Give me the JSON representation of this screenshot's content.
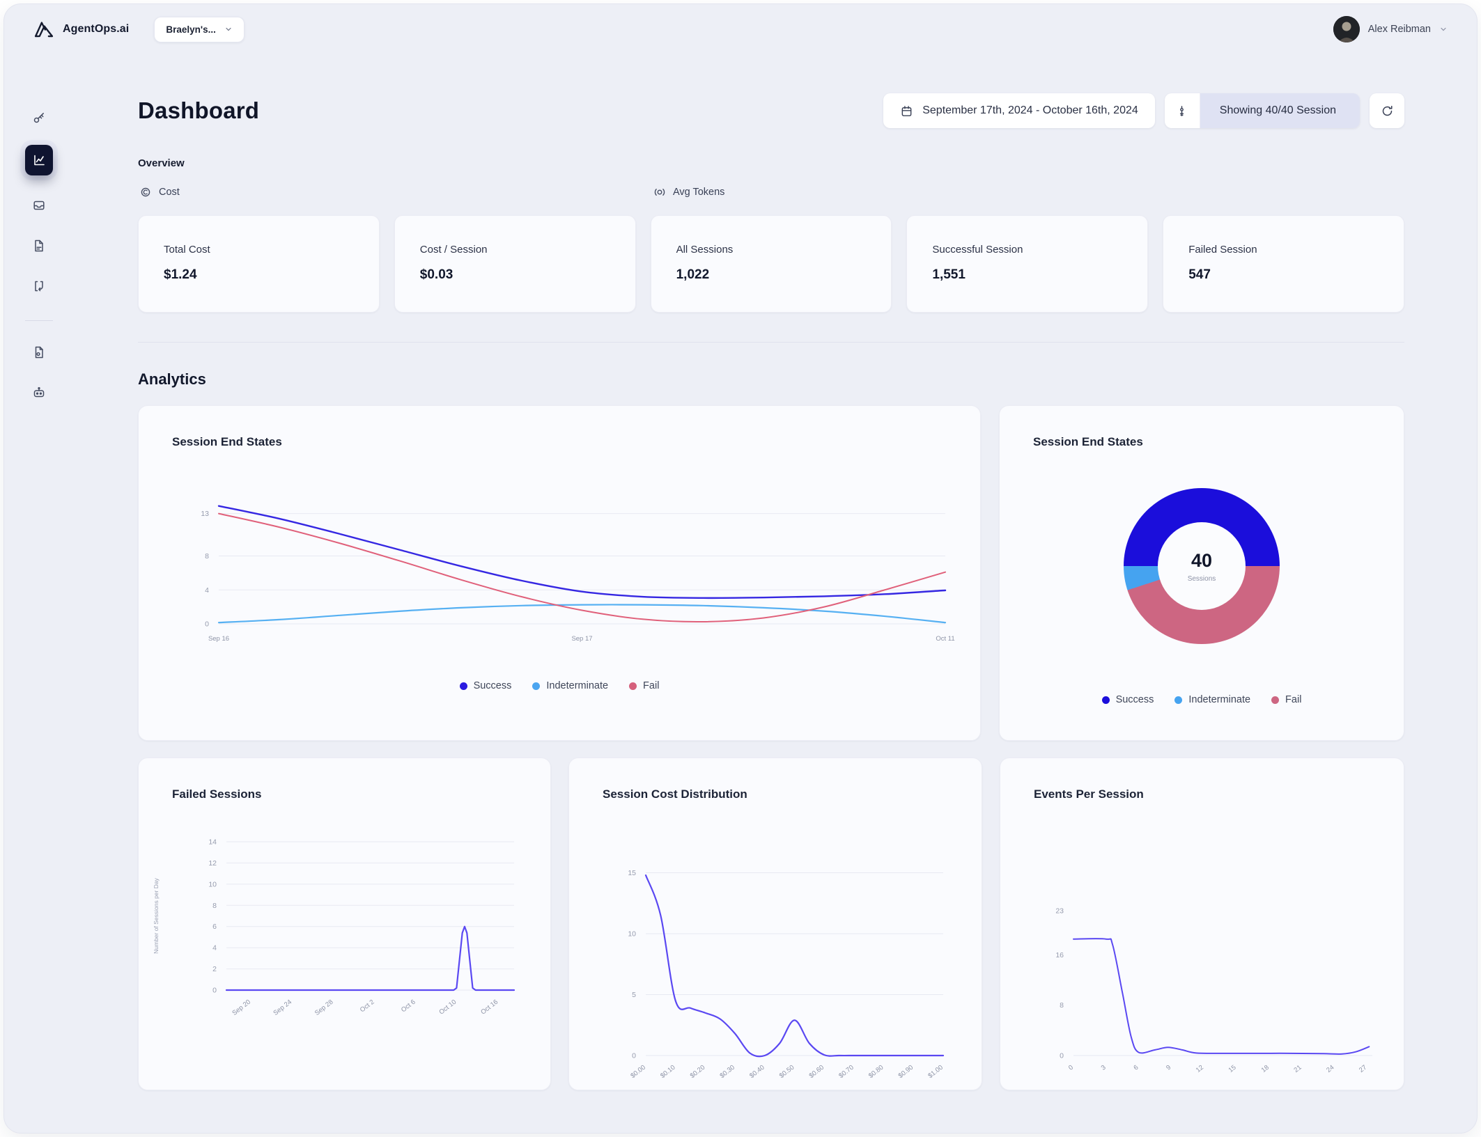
{
  "app": {
    "brand": "AgentOps.ai",
    "project_selector": "Braelyn's...",
    "user_name": "Alex Reibman"
  },
  "header": {
    "title": "Dashboard",
    "date_range": "September 17th, 2024 - October 16th, 2024",
    "session_filter": "Showing 40/40 Session"
  },
  "overview": {
    "section_label": "Overview",
    "toggles": [
      {
        "label": "Cost"
      },
      {
        "label": "Avg Tokens"
      }
    ],
    "stats": [
      {
        "label": "Total Cost",
        "value": "$1.24"
      },
      {
        "label": "Cost / Session",
        "value": "$0.03"
      },
      {
        "label": "All Sessions",
        "value": "1,022"
      },
      {
        "label": "Successful Session",
        "value": "1,551"
      },
      {
        "label": "Failed Session",
        "value": "547"
      }
    ]
  },
  "analytics": {
    "section_label": "Analytics"
  },
  "chart_data": [
    {
      "type": "line",
      "title": "Session End States",
      "x_ticks": [
        "Sep 16",
        "Sep 17",
        "Oct 11"
      ],
      "xtick_pos": [
        0,
        0.5,
        1
      ],
      "ylim": [
        0,
        14.2
      ],
      "yticks": [
        13,
        8,
        4,
        0
      ],
      "grid": true,
      "legend_position": "bottom",
      "series": [
        {
          "name": "Success",
          "color": "#3527e2",
          "width": 2.4,
          "values": [
            13.9,
            12.4,
            10.6,
            8.7,
            6.8,
            5.1,
            3.8,
            3.2,
            3.05,
            3.1,
            3.25,
            3.5,
            3.95
          ]
        },
        {
          "name": "Indeterminate",
          "color": "#56b0f2",
          "width": 2.2,
          "values": [
            0.15,
            0.5,
            1.0,
            1.5,
            1.9,
            2.15,
            2.25,
            2.25,
            2.15,
            1.9,
            1.5,
            0.9,
            0.15
          ]
        },
        {
          "name": "Fail",
          "color": "#e0607a",
          "width": 2,
          "values": [
            13.0,
            11.4,
            9.5,
            7.4,
            5.2,
            3.2,
            1.6,
            0.55,
            0.25,
            0.7,
            2.0,
            4.0,
            6.1
          ]
        }
      ],
      "legend": [
        {
          "label": "Success",
          "color": "#2a1ae0"
        },
        {
          "label": "Indeterminate",
          "color": "#4ba5f0"
        },
        {
          "label": "Fail",
          "color": "#d5607c"
        }
      ]
    },
    {
      "type": "pie",
      "title": "Session End States",
      "center_value": "40",
      "center_label": "Sessions",
      "slices": [
        {
          "label": "Success",
          "value": 20,
          "color": "#1b0edb"
        },
        {
          "label": "Fail",
          "value": 18,
          "color": "#cd6682"
        },
        {
          "label": "Indeterminate",
          "value": 2,
          "color": "#45a3f0"
        }
      ],
      "legend_position": "bottom",
      "legend": [
        {
          "label": "Success",
          "color": "#1b0edb"
        },
        {
          "label": "Indeterminate",
          "color": "#45a3f0"
        },
        {
          "label": "Fail",
          "color": "#cd6682"
        }
      ]
    },
    {
      "type": "line",
      "title": "Failed Sessions",
      "ylabel": "Number of Sessions per Day",
      "x_ticks": [
        "Sep 20",
        "Sep 24",
        "Sep 28",
        "Oct 2",
        "Oct 6",
        "Oct 10",
        "Oct 16"
      ],
      "xtick_pos": [
        0.085,
        0.228,
        0.372,
        0.515,
        0.658,
        0.8,
        0.945
      ],
      "ylim": [
        0,
        14
      ],
      "yticks": [
        14,
        12,
        10,
        8,
        6,
        4,
        2,
        0
      ],
      "grid": true,
      "smooth": false,
      "series": [
        {
          "name": "Failed Sessions",
          "color": "#5a48f2",
          "width": 2.2,
          "x": [
            0,
            0.3,
            0.6,
            0.79,
            0.8,
            0.82,
            0.828,
            0.836,
            0.856,
            0.866,
            0.93,
            1
          ],
          "y": [
            0,
            0,
            0,
            0,
            0.2,
            5.4,
            6,
            5.4,
            0.2,
            0,
            0,
            0
          ]
        }
      ]
    },
    {
      "type": "line",
      "title": "Session Cost Distribution",
      "x_ticks": [
        "$0.00",
        "$0.10",
        "$0.20",
        "$0.30",
        "$0.40",
        "$0.50",
        "$0.60",
        "$0.70",
        "$0.80",
        "$0.90",
        "$1.00"
      ],
      "ylim": [
        0,
        16
      ],
      "yticks": [
        15,
        10,
        5,
        0
      ],
      "grid": true,
      "series": [
        {
          "name": "Sessions",
          "color": "#5a48f2",
          "width": 2.2,
          "values": [
            14.8,
            11.5,
            4.5,
            3.9,
            3.5,
            3.0,
            1.8,
            0.2,
            0,
            1.0,
            2.9,
            1.0,
            0.05,
            0,
            0,
            0,
            0,
            0,
            0,
            0,
            0
          ]
        }
      ]
    },
    {
      "type": "line",
      "title": "Events Per Session",
      "x_ticks": [
        "0",
        "3",
        "6",
        "9",
        "12",
        "15",
        "18",
        "21",
        "24",
        "27"
      ],
      "xtick_pos": [
        0,
        0.109,
        0.218,
        0.327,
        0.436,
        0.545,
        0.655,
        0.764,
        0.873,
        0.982
      ],
      "xmax": 27.5,
      "ylim": [
        0,
        24
      ],
      "yticks": [
        23,
        16,
        8,
        0
      ],
      "grid": false,
      "series": [
        {
          "name": "Sessions",
          "color": "#5a48f2",
          "width": 2,
          "x": [
            0,
            3,
            3.6,
            4.5,
            5.3,
            6,
            7.5,
            8.7,
            10,
            11.3,
            14,
            17,
            20,
            23,
            24.7,
            26,
            27.2
          ],
          "y": [
            18.5,
            18.5,
            17.6,
            10,
            3,
            0.5,
            0.9,
            1.3,
            0.9,
            0.4,
            0.35,
            0.35,
            0.35,
            0.3,
            0.25,
            0.6,
            1.4
          ]
        }
      ]
    }
  ],
  "colors": {
    "accent_indigo": "#5a48f2",
    "success_blue": "#2a1ae0",
    "indeterminate_blue": "#4ba5f0",
    "fail_rose": "#d5607c",
    "background": "#edeff6"
  }
}
